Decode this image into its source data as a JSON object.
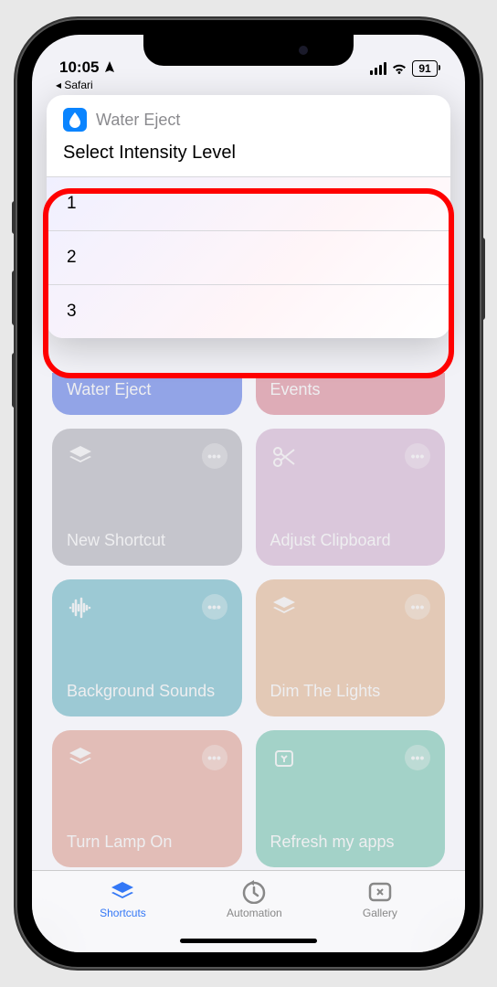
{
  "status": {
    "time": "10:05",
    "back_app": "◂ Safari",
    "battery": "91"
  },
  "modal": {
    "app_name": "Water Eject",
    "prompt": "Select Intensity Level",
    "options": [
      "1",
      "2",
      "3"
    ]
  },
  "shortcuts": {
    "row_peek": [
      "Water Eject",
      "Events"
    ],
    "tiles": [
      {
        "label": "New Shortcut",
        "color": "tile-gray",
        "icon": "stack"
      },
      {
        "label": "Adjust Clipboard",
        "color": "tile-pink",
        "icon": "scissors"
      },
      {
        "label": "Background Sounds",
        "color": "tile-teal",
        "icon": "waveform"
      },
      {
        "label": "Dim The Lights",
        "color": "tile-orange",
        "icon": "stack"
      },
      {
        "label": "Turn Lamp On",
        "color": "tile-coral",
        "icon": "stack"
      },
      {
        "label": "Refresh my apps",
        "color": "tile-mint",
        "icon": "square"
      }
    ]
  },
  "tabs": {
    "shortcuts": "Shortcuts",
    "automation": "Automation",
    "gallery": "Gallery"
  }
}
